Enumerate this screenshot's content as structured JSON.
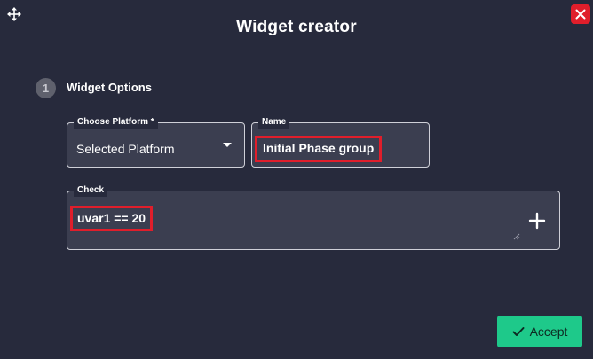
{
  "window": {
    "title": "Widget creator"
  },
  "icons": {
    "move": "move-icon",
    "close": "close-icon",
    "add": "plus-icon",
    "check": "check-icon"
  },
  "colors": {
    "background": "#272a3c",
    "field_bg": "#3b3e50",
    "close": "#e01e2b",
    "accept": "#1ec98a",
    "highlight": "#e01e2b"
  },
  "step": {
    "number": "1",
    "label": "Widget Options"
  },
  "fields": {
    "platform": {
      "legend": "Choose Platform *",
      "value": "Selected Platform"
    },
    "name": {
      "legend": "Name",
      "value": "Initial Phase group"
    },
    "check": {
      "legend": "Check",
      "value": "uvar1 == 20"
    }
  },
  "actions": {
    "accept_label": "Accept"
  }
}
